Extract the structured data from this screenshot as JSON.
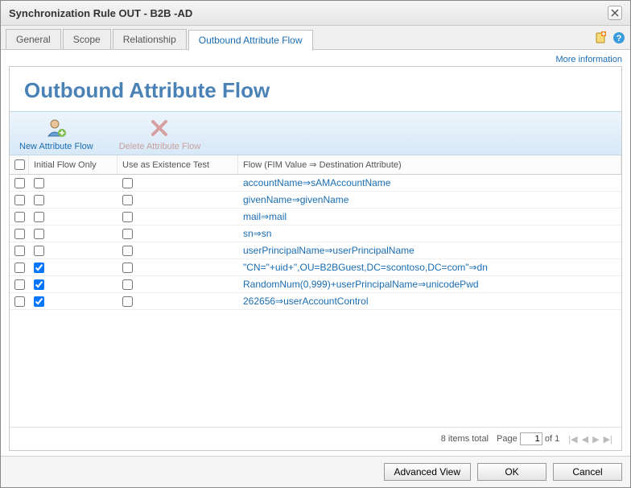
{
  "window": {
    "title": "Synchronization Rule OUT - B2B -AD"
  },
  "tabs": [
    {
      "label": "General",
      "active": false
    },
    {
      "label": "Scope",
      "active": false
    },
    {
      "label": "Relationship",
      "active": false
    },
    {
      "label": "Outbound Attribute Flow",
      "active": true
    }
  ],
  "links": {
    "more_information": "More information"
  },
  "heading": "Outbound Attribute Flow",
  "toolbar": {
    "new": "New Attribute Flow",
    "delete": "Delete Attribute Flow"
  },
  "columns": {
    "initial": "Initial Flow Only",
    "existence": "Use as Existence Test",
    "flow": "Flow (FIM Value ⇒ Destination Attribute)"
  },
  "rows": [
    {
      "selected": false,
      "initial": false,
      "existence": false,
      "flow": "accountName⇒sAMAccountName"
    },
    {
      "selected": false,
      "initial": false,
      "existence": false,
      "flow": "givenName⇒givenName"
    },
    {
      "selected": false,
      "initial": false,
      "existence": false,
      "flow": "mail⇒mail"
    },
    {
      "selected": false,
      "initial": false,
      "existence": false,
      "flow": "sn⇒sn"
    },
    {
      "selected": false,
      "initial": false,
      "existence": false,
      "flow": "userPrincipalName⇒userPrincipalName"
    },
    {
      "selected": false,
      "initial": true,
      "existence": false,
      "flow": "\"CN=\"+uid+\",OU=B2BGuest,DC=scontoso,DC=com\"⇒dn"
    },
    {
      "selected": false,
      "initial": true,
      "existence": false,
      "flow": "RandomNum(0,999)+userPrincipalName⇒unicodePwd"
    },
    {
      "selected": false,
      "initial": true,
      "existence": false,
      "flow": "262656⇒userAccountControl"
    }
  ],
  "pager": {
    "items_total": "8 items total",
    "page_label": "Page",
    "page": "1",
    "of_label": "of",
    "total_pages": "1"
  },
  "buttons": {
    "advanced": "Advanced View",
    "ok": "OK",
    "cancel": "Cancel"
  }
}
